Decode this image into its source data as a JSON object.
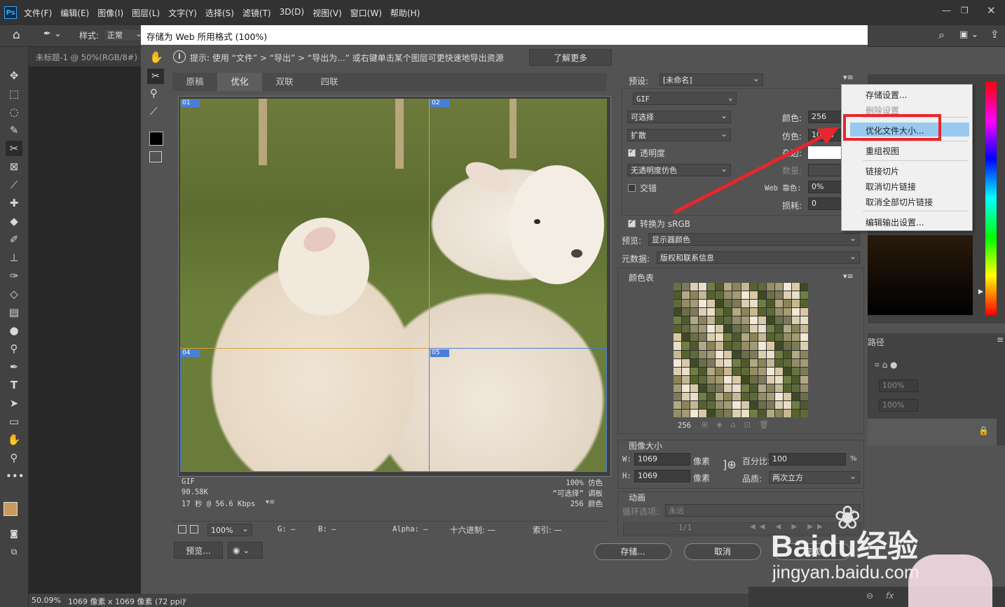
{
  "menubar": {
    "items": [
      "文件(F)",
      "编辑(E)",
      "图像(I)",
      "图层(L)",
      "文字(Y)",
      "选择(S)",
      "滤镜(T)",
      "3D(D)",
      "视图(V)",
      "窗口(W)",
      "帮助(H)"
    ],
    "logo": "Ps"
  },
  "options_bar": {
    "style_label": "样式:",
    "style_value": "正常"
  },
  "doc_tab": {
    "title": "未标题-1 @ 50%(RGB/8#)"
  },
  "status_bar": {
    "zoom": "50.09%",
    "info": "1069 像素 x 1069 像素 (72 ppi)"
  },
  "dialog": {
    "title": "存储为 Web 所用格式 (100%)",
    "hint": "提示: 使用 “文件” > “导出” > “导出为...” 或右键单击某个图层可更快速地导出资源",
    "learn_more": "了解更多",
    "tabs": [
      "原稿",
      "优化",
      "双联",
      "四联"
    ],
    "active_tab": "优化",
    "slices": [
      "01",
      "02",
      "04",
      "05"
    ],
    "image_info": {
      "format": "GIF",
      "size": "90.58K",
      "time": "17 秒 @ 56.6 Kbps",
      "dither": "100% 仿色",
      "palette": "“可选择” 调板",
      "colors": "256 颜色"
    },
    "bottom_bar": {
      "zoom": "100%",
      "g_label": "G: —",
      "b_label": "B: —",
      "alpha_label": "Alpha: —",
      "hex_label": "十六进制: —",
      "index_label": "索引: —"
    },
    "buttons": {
      "preview": "预览...",
      "save": "存储...",
      "cancel": "取消",
      "done": "完成"
    },
    "settings": {
      "preset_label": "预设:",
      "preset_value": "[未命名]",
      "format": "GIF",
      "reduction": "可选择",
      "dither_algo": "扩散",
      "transparency_label": "透明度",
      "transparency_checked": true,
      "trans_dither": "无透明度仿色",
      "interlaced_label": "交错",
      "interlaced_checked": false,
      "colors_label": "颜色:",
      "colors_value": "256",
      "dither_label": "仿色:",
      "dither_value": "100%",
      "matte_label": "杂边:",
      "amount_label": "数量:",
      "web_snap_label": "Web 靠色:",
      "web_snap_value": "0%",
      "lossy_label": "损耗:",
      "lossy_value": "0",
      "srgb_label": "转换为 sRGB",
      "srgb_checked": true,
      "preview_label": "预览:",
      "preview_value": "显示器颜色",
      "metadata_label": "元数据:",
      "metadata_value": "版权和联系信息",
      "color_table_label": "颜色表",
      "color_table_count": "256",
      "image_size_label": "图像大小",
      "w_label": "W:",
      "w_value": "1069",
      "h_label": "H:",
      "h_value": "1069",
      "unit": "像素",
      "percent_label": "百分比:",
      "percent_value": "100",
      "percent_sign": "%",
      "quality_label": "品质:",
      "quality_value": "两次立方",
      "animation_label": "动画",
      "loop_label": "循环选项:",
      "loop_value": "永远",
      "frame": "1/1"
    }
  },
  "context_menu": {
    "items": [
      {
        "label": "存储设置...",
        "disabled": false
      },
      {
        "label": "删除设置",
        "disabled": true
      },
      {
        "label": "优化文件大小...",
        "disabled": false,
        "highlighted": true
      },
      {
        "label": "重组视图",
        "disabled": false
      },
      {
        "label": "链接切片",
        "disabled": false
      },
      {
        "label": "取消切片链接",
        "disabled": false
      },
      {
        "label": "取消全部切片链接",
        "disabled": false
      },
      {
        "label": "编辑输出设置...",
        "disabled": false
      }
    ]
  },
  "right_panel": {
    "tab_label": "路径",
    "opacity1": "100%",
    "opacity2": "100%"
  },
  "watermark": {
    "brand": "Baidu经验",
    "url": "jingyan.baidu.com"
  },
  "colors": {
    "accent_red": "#e8262b",
    "menu_highlight": "#99c9ef",
    "slice_blue": "#4a7fd6",
    "slice_orange": "#d9a23a"
  }
}
